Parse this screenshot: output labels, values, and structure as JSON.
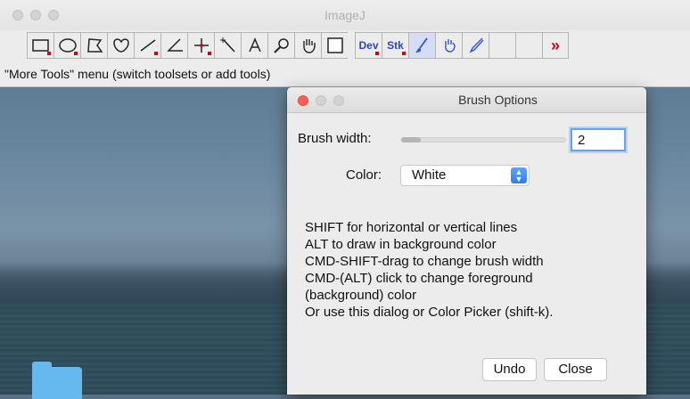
{
  "imagej": {
    "title": "ImageJ",
    "toolbar": {
      "dev_label": "Dev",
      "stk_label": "Stk",
      "more_label": "»"
    },
    "status": "\"More Tools\" menu (switch toolsets or add tools)"
  },
  "dialog": {
    "title": "Brush Options",
    "brush_width_label": "Brush width:",
    "brush_width_value": "2",
    "brush_width_slider_fraction": 0.12,
    "color_label": "Color:",
    "color_value": "White",
    "help_lines": [
      "SHIFT for horizontal or vertical lines",
      "ALT to draw in background color",
      "CMD-SHIFT-drag to change brush width",
      "CMD-(ALT) click to change foreground",
      "(background) color",
      "Or use this dialog or Color Picker (shift-k)."
    ],
    "undo_label": "Undo",
    "close_label": "Close"
  },
  "colors": {
    "close_dot": "#fc605b",
    "focus_ring": "#6aa2ea",
    "select_arrows": "#3b88ef",
    "dev_stk_text": "#2a47c8",
    "more_arrow": "#d0021b"
  }
}
